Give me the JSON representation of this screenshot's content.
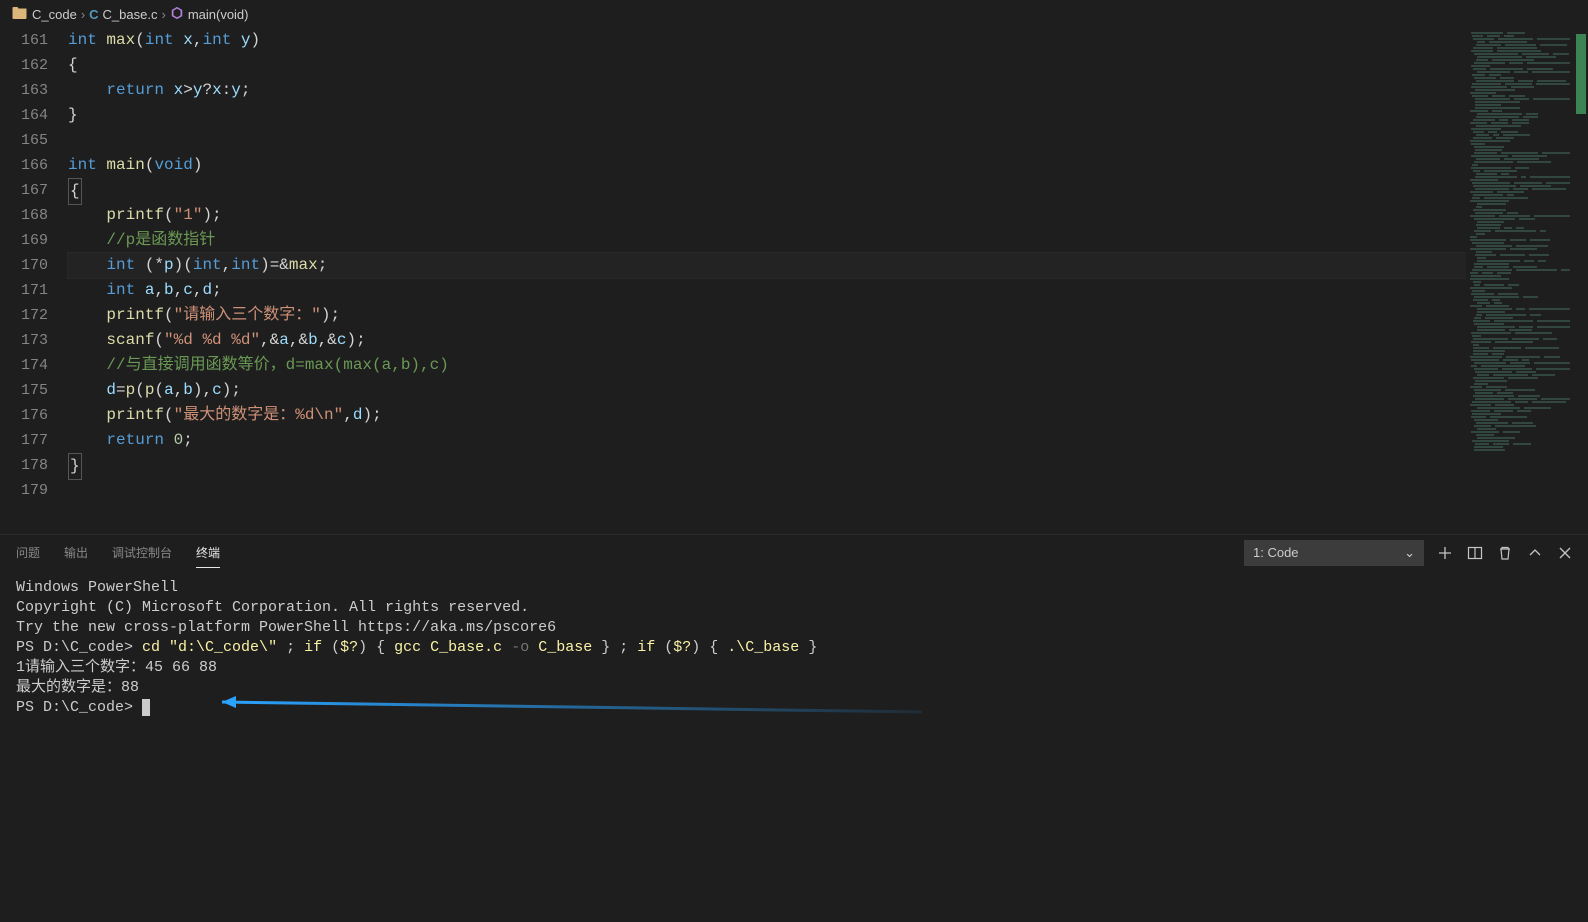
{
  "breadcrumb": {
    "folder": "C_code",
    "file": "C_base.c",
    "symbol": "main(void)"
  },
  "editor": {
    "startLine": 161,
    "activeLine": 170,
    "lines": [
      [
        [
          "int",
          "tok-type"
        ],
        [
          " "
        ],
        [
          "max",
          "tok-func"
        ],
        [
          "(",
          "tok-paren"
        ],
        [
          "int",
          "tok-type"
        ],
        [
          " "
        ],
        [
          "x",
          "tok-var"
        ],
        [
          ",",
          "tok-punct"
        ],
        [
          "int",
          "tok-type"
        ],
        [
          " "
        ],
        [
          "y",
          "tok-var"
        ],
        [
          ")",
          "tok-paren"
        ]
      ],
      [
        [
          "{",
          "tok-punct"
        ]
      ],
      [
        [
          "    "
        ],
        [
          "return",
          "tok-keyword"
        ],
        [
          " "
        ],
        [
          "x",
          "tok-var"
        ],
        [
          ">",
          "tok-punct"
        ],
        [
          "y",
          "tok-var"
        ],
        [
          "?",
          "tok-punct"
        ],
        [
          "x",
          "tok-var"
        ],
        [
          ":",
          "tok-punct"
        ],
        [
          "y",
          "tok-var"
        ],
        [
          ";",
          "tok-punct"
        ]
      ],
      [
        [
          "}",
          "tok-punct"
        ]
      ],
      [],
      [
        [
          "int",
          "tok-type"
        ],
        [
          " "
        ],
        [
          "main",
          "tok-func"
        ],
        [
          "(",
          "tok-paren"
        ],
        [
          "void",
          "tok-type"
        ],
        [
          ")",
          "tok-paren"
        ]
      ],
      [
        [
          "{",
          "tok-punct",
          "bracket-box"
        ]
      ],
      [
        [
          "    "
        ],
        [
          "printf",
          "tok-func"
        ],
        [
          "(",
          "tok-paren"
        ],
        [
          "\"1\"",
          "tok-string"
        ],
        [
          ")",
          "tok-paren"
        ],
        [
          ";",
          "tok-punct"
        ]
      ],
      [
        [
          "    "
        ],
        [
          "//p是函数指针",
          "tok-comment"
        ]
      ],
      [
        [
          "    "
        ],
        [
          "int",
          "tok-type"
        ],
        [
          " (*",
          "tok-punct"
        ],
        [
          "p",
          "tok-var"
        ],
        [
          ")(",
          "tok-punct"
        ],
        [
          "int",
          "tok-type"
        ],
        [
          ",",
          "tok-punct"
        ],
        [
          "int",
          "tok-type"
        ],
        [
          ")",
          "tok-punct"
        ],
        [
          "=&",
          "tok-punct"
        ],
        [
          "max",
          "tok-func"
        ],
        [
          ";",
          "tok-punct"
        ]
      ],
      [
        [
          "    "
        ],
        [
          "int",
          "tok-type"
        ],
        [
          " "
        ],
        [
          "a",
          "tok-var"
        ],
        [
          ",",
          "tok-punct"
        ],
        [
          "b",
          "tok-var"
        ],
        [
          ",",
          "tok-punct"
        ],
        [
          "c",
          "tok-var"
        ],
        [
          ",",
          "tok-punct"
        ],
        [
          "d",
          "tok-var"
        ],
        [
          ";",
          "tok-punct"
        ]
      ],
      [
        [
          "    "
        ],
        [
          "printf",
          "tok-func"
        ],
        [
          "(",
          "tok-paren"
        ],
        [
          "\"请输入三个数字：\"",
          "tok-string"
        ],
        [
          ")",
          "tok-paren"
        ],
        [
          ";",
          "tok-punct"
        ]
      ],
      [
        [
          "    "
        ],
        [
          "scanf",
          "tok-func"
        ],
        [
          "(",
          "tok-paren"
        ],
        [
          "\"%d %d %d\"",
          "tok-string"
        ],
        [
          ",&",
          "tok-punct"
        ],
        [
          "a",
          "tok-var"
        ],
        [
          ",&",
          "tok-punct"
        ],
        [
          "b",
          "tok-var"
        ],
        [
          ",&",
          "tok-punct"
        ],
        [
          "c",
          "tok-var"
        ],
        [
          ")",
          "tok-paren"
        ],
        [
          ";",
          "tok-punct"
        ]
      ],
      [
        [
          "    "
        ],
        [
          "//与直接调用函数等价，d=max(max(a,b),c)",
          "tok-comment"
        ]
      ],
      [
        [
          "    "
        ],
        [
          "d",
          "tok-var"
        ],
        [
          "=",
          "tok-punct"
        ],
        [
          "p",
          "tok-func"
        ],
        [
          "(",
          "tok-paren"
        ],
        [
          "p",
          "tok-func"
        ],
        [
          "(",
          "tok-paren"
        ],
        [
          "a",
          "tok-var"
        ],
        [
          ",",
          "tok-punct"
        ],
        [
          "b",
          "tok-var"
        ],
        [
          ")",
          "tok-paren"
        ],
        [
          ",",
          "tok-punct"
        ],
        [
          "c",
          "tok-var"
        ],
        [
          ")",
          "tok-paren"
        ],
        [
          ";",
          "tok-punct"
        ]
      ],
      [
        [
          "    "
        ],
        [
          "printf",
          "tok-func"
        ],
        [
          "(",
          "tok-paren"
        ],
        [
          "\"最大的数字是：%d\\n\"",
          "tok-string"
        ],
        [
          ",",
          "tok-punct"
        ],
        [
          "d",
          "tok-var"
        ],
        [
          ")",
          "tok-paren"
        ],
        [
          ";",
          "tok-punct"
        ]
      ],
      [
        [
          "    "
        ],
        [
          "return",
          "tok-keyword"
        ],
        [
          " "
        ],
        [
          "0",
          "tok-num"
        ],
        [
          ";",
          "tok-punct"
        ]
      ],
      [
        [
          "}",
          "tok-punct",
          "bracket-box"
        ]
      ],
      []
    ]
  },
  "panel": {
    "tabs": [
      "问题",
      "输出",
      "调试控制台",
      "终端"
    ],
    "activeTab": 3,
    "terminalSelect": "1: Code"
  },
  "terminal": {
    "lines": [
      {
        "segments": [
          [
            "Windows PowerShell",
            ""
          ]
        ]
      },
      {
        "segments": [
          [
            "Copyright (C) Microsoft Corporation. All rights reserved.",
            ""
          ]
        ]
      },
      {
        "segments": [
          [
            "",
            ""
          ]
        ]
      },
      {
        "segments": [
          [
            "Try the new cross-platform PowerShell https://aka.ms/pscore6",
            ""
          ]
        ]
      },
      {
        "segments": [
          [
            "",
            ""
          ]
        ]
      },
      {
        "segments": [
          [
            "PS D:\\C_code> ",
            ""
          ],
          [
            "cd ",
            "ps-yellow"
          ],
          [
            "\"d:\\C_code\\\"",
            "ps-yellow"
          ],
          [
            " ; ",
            ""
          ],
          [
            "if",
            "ps-yellow"
          ],
          [
            " (",
            ""
          ],
          [
            "$?",
            "ps-yellow"
          ],
          [
            ") { ",
            ""
          ],
          [
            "gcc C_base.c ",
            "ps-yellow"
          ],
          [
            "-o",
            "ps-gray"
          ],
          [
            " C_base ",
            "ps-yellow"
          ],
          [
            "} ; ",
            ""
          ],
          [
            "if",
            "ps-yellow"
          ],
          [
            " (",
            ""
          ],
          [
            "$?",
            "ps-yellow"
          ],
          [
            ") { ",
            ""
          ],
          [
            ".\\C_base ",
            "ps-yellow"
          ],
          [
            "}",
            ""
          ]
        ]
      },
      {
        "segments": [
          [
            "1请输入三个数字：45 66 88",
            ""
          ]
        ]
      },
      {
        "segments": [
          [
            "最大的数字是：88",
            ""
          ]
        ]
      },
      {
        "segments": [
          [
            "PS D:\\C_code> ",
            ""
          ]
        ],
        "cursor": true
      }
    ]
  }
}
